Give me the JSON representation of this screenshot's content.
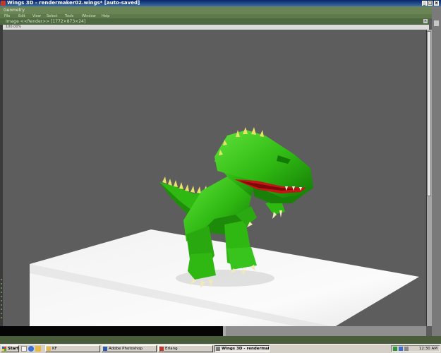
{
  "window": {
    "title": "Wings 3D - rendermaker02.wings* [auto-saved]",
    "controls": [
      "_",
      "□",
      "×"
    ]
  },
  "geometry_bar": {
    "label": "Geometry"
  },
  "menu": {
    "items": [
      "File",
      "Edit",
      "View",
      "Select",
      "Tools",
      "Window",
      "Help"
    ]
  },
  "image_window": {
    "title": "Image <<Render>> [1772×873×24]",
    "zoom": "100.00%",
    "close": "×"
  },
  "scene": {
    "subject": "green dinosaur on white plane",
    "colors": {
      "background": "#5d5d5d",
      "body": "#35c418",
      "mouth": "#c41616",
      "spikes": "#e8e26a",
      "floor": "#f4f4f4"
    }
  },
  "taskbar": {
    "start_label": "Start",
    "buttons": [
      "KF",
      "Adobe Photoshop",
      "Erlang",
      "Wings 3D - rendermak..."
    ],
    "clock": "12:30 AM"
  }
}
